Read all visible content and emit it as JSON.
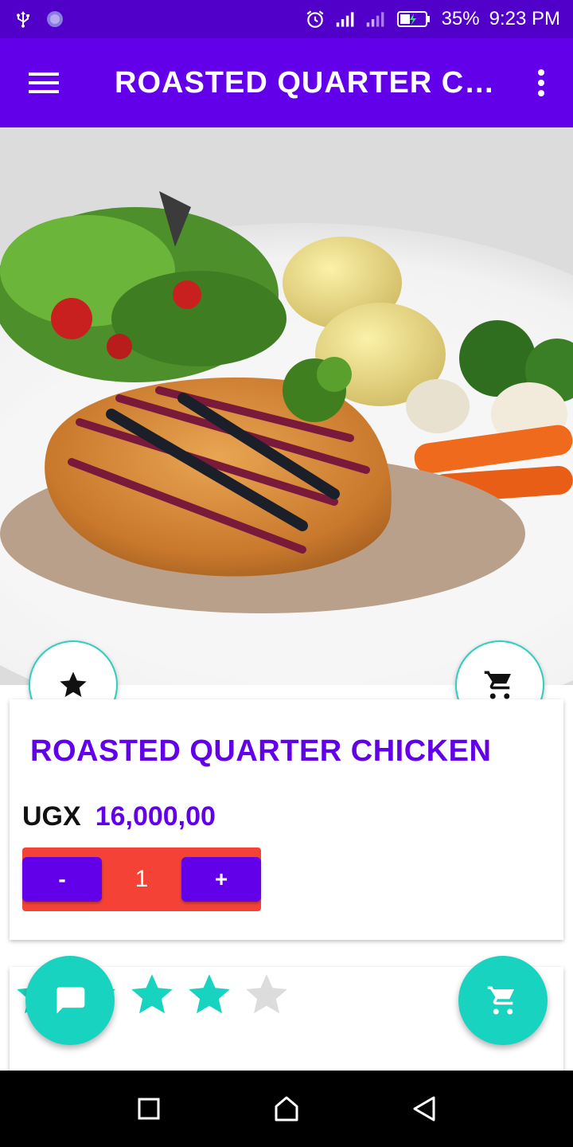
{
  "status_bar": {
    "battery_percent": "35%",
    "time": "9:23 PM",
    "icons": [
      "usb-icon",
      "app-notification-icon",
      "alarm-icon",
      "signal-icon",
      "signal-icon",
      "battery-charging-icon"
    ]
  },
  "app_bar": {
    "title": "ROASTED QUARTER CH…",
    "icons": [
      "menu-icon",
      "more-vert-icon"
    ]
  },
  "hero": {
    "image_semantic": "roasted chicken plate photo"
  },
  "product": {
    "name": "ROASTED QUARTER CHICKEN",
    "currency": "UGX",
    "price": "16,000,00",
    "quantity": "1",
    "minus_label": "-",
    "plus_label": "+"
  },
  "rating": {
    "stars_filled": 3,
    "stars_total": 4
  },
  "colors": {
    "primary": "#6200ea",
    "status_bar": "#5000c8",
    "accent": "#17d3c0",
    "qty_bg": "#f44336"
  },
  "nav_bar": {
    "icons": [
      "recents-icon",
      "home-icon",
      "back-icon"
    ]
  }
}
